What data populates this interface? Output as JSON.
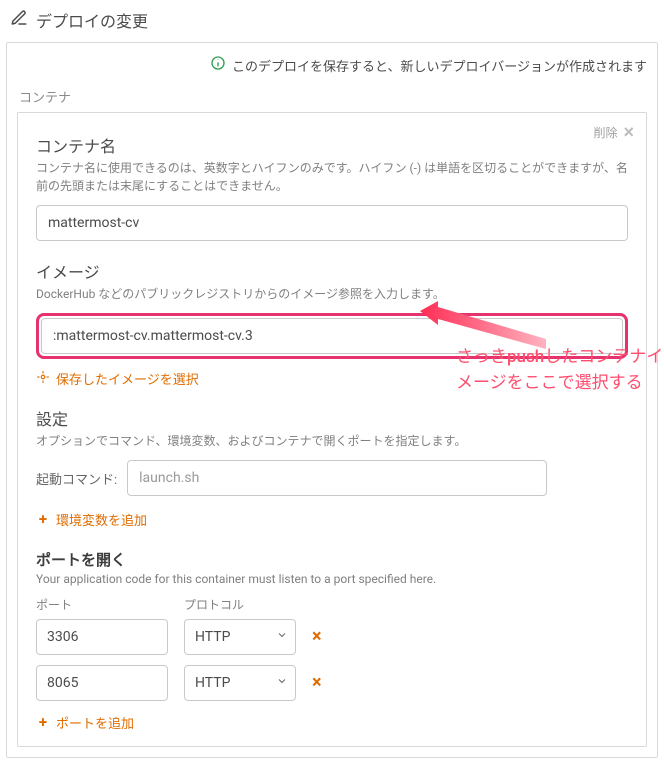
{
  "page": {
    "title": "デプロイの変更"
  },
  "notice": {
    "text": "このデプロイを保存すると、新しいデプロイバージョンが作成されます"
  },
  "container": {
    "section_label": "コンテナ",
    "delete_label": "削除",
    "name": {
      "label": "コンテナ名",
      "help": "コンテナ名に使用できるのは、英数字とハイフンのみです。ハイフン (-) は単語を区切ることができますが、名前の先頭または末尾にすることはできません。",
      "value": "mattermost-cv"
    },
    "image": {
      "label": "イメージ",
      "help": "DockerHub などのパブリックレジストリからのイメージ参照を入力します。",
      "value": ":mattermost-cv.mattermost-cv.3",
      "select_saved_label": "保存したイメージを選択"
    },
    "settings": {
      "label": "設定",
      "help": "オプションでコマンド、環境変数、およびコンテナで開くポートを指定します。",
      "launch_command_label": "起動コマンド:",
      "launch_command_placeholder": "launch.sh",
      "add_env_label": "環境変数を追加"
    },
    "ports": {
      "heading": "ポートを開く",
      "help": "Your application code for this container must listen to a port specified here.",
      "col_port": "ポート",
      "col_protocol": "プロトコル",
      "rows": [
        {
          "port": "3306",
          "protocol": "HTTP"
        },
        {
          "port": "8065",
          "protocol": "HTTP"
        }
      ],
      "add_port_label": "ポートを追加"
    }
  },
  "annotation": {
    "text": "さっきpushしたコンテナイメージをここで選択する"
  }
}
